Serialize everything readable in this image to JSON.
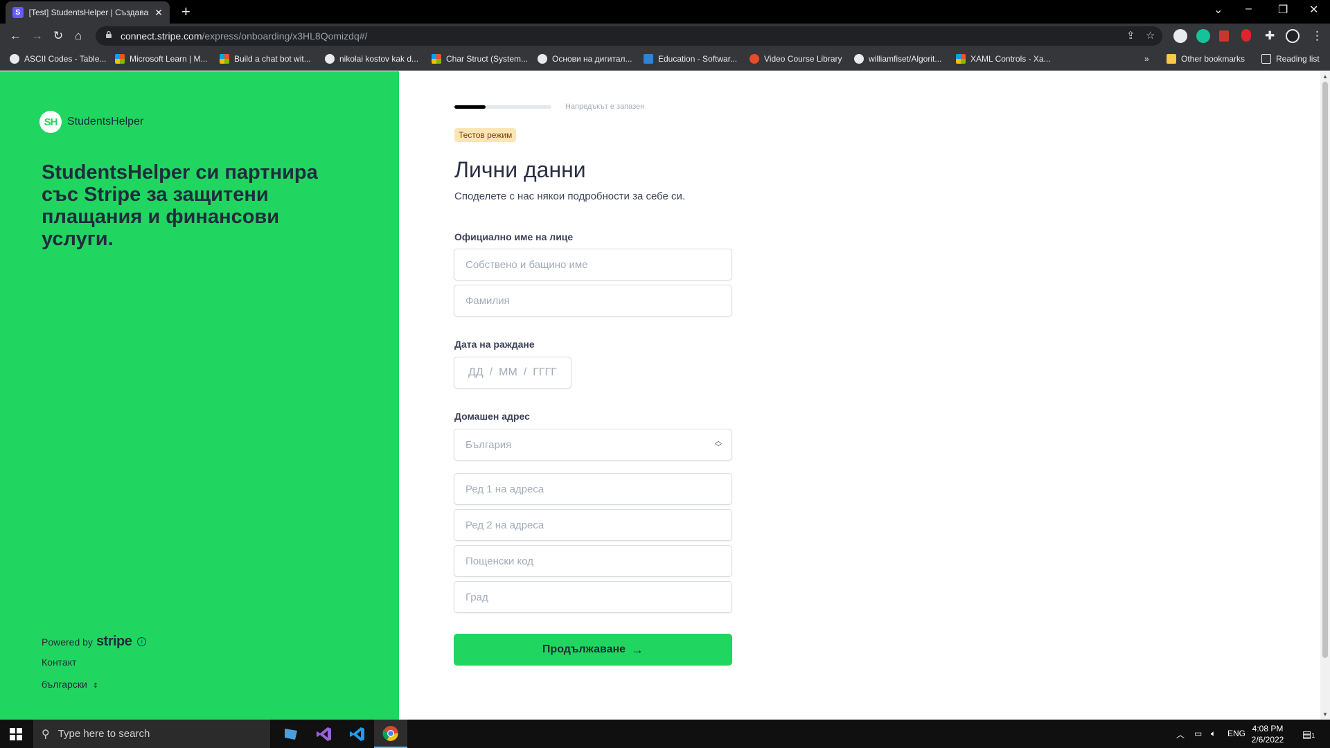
{
  "browser": {
    "tab_title": "[Test] StudentsHelper | Създаван",
    "tab_favicon": "S",
    "url_host": "connect.stripe.com",
    "url_path": "/express/onboarding/x3HL8Qomizdq#/",
    "bookmarks": [
      {
        "label": "ASCII Codes - Table...",
        "icon": "globe-icon"
      },
      {
        "label": "Microsoft Learn | M...",
        "icon": "microsoft-icon"
      },
      {
        "label": "Build a chat bot wit...",
        "icon": "microsoft-icon"
      },
      {
        "label": "nikolai kostov kak d...",
        "icon": "google-icon"
      },
      {
        "label": "Char Struct (System...",
        "icon": "microsoft-icon"
      },
      {
        "label": "Основи на дигитал...",
        "icon": "google-icon"
      },
      {
        "label": "Education - Softwar...",
        "icon": "azure-icon"
      },
      {
        "label": "Video Course Library",
        "icon": "play-icon"
      },
      {
        "label": "williamfiset/Algorit...",
        "icon": "github-icon"
      },
      {
        "label": "XAML Controls - Xa...",
        "icon": "microsoft-icon"
      }
    ],
    "bookmarks_overflow": "»",
    "other_bookmarks": "Other bookmarks",
    "reading_list": "Reading list"
  },
  "brand": {
    "logo_text": "SH",
    "name": "StudentsHelper",
    "headline": "StudentsHelper си партнира със Stripe за защитени плащания и финансови услуги.",
    "powered_by": "Powered by",
    "stripe": "stripe",
    "contact": "Контакт",
    "language": "български",
    "accent_color": "#21d660"
  },
  "form": {
    "progress_fraction": 0.32,
    "saved_note": "Напредъкът е запазен",
    "test_badge": "Тестов режим",
    "title": "Лични данни",
    "subtitle": "Споделете с нас някои подробности за себе си.",
    "name_label": "Официално име на лице",
    "first_name_placeholder": "Собствено и бащино име",
    "last_name_placeholder": "Фамилия",
    "dob_label": "Дата на раждане",
    "dob_day": "ДД",
    "dob_month": "ММ",
    "dob_year": "ГГГГ",
    "dob_sep": "/",
    "address_label": "Домашен адрес",
    "country_value": "България",
    "address1_placeholder": "Ред 1 на адреса",
    "address2_placeholder": "Ред 2 на адреса",
    "postal_placeholder": "Пощенски код",
    "city_placeholder": "Град",
    "continue_label": "Продължаване"
  },
  "taskbar": {
    "search_placeholder": "Type here to search",
    "lang": "ENG",
    "time": "4:08 PM",
    "date": "2/6/2022",
    "notification_count": "1"
  }
}
